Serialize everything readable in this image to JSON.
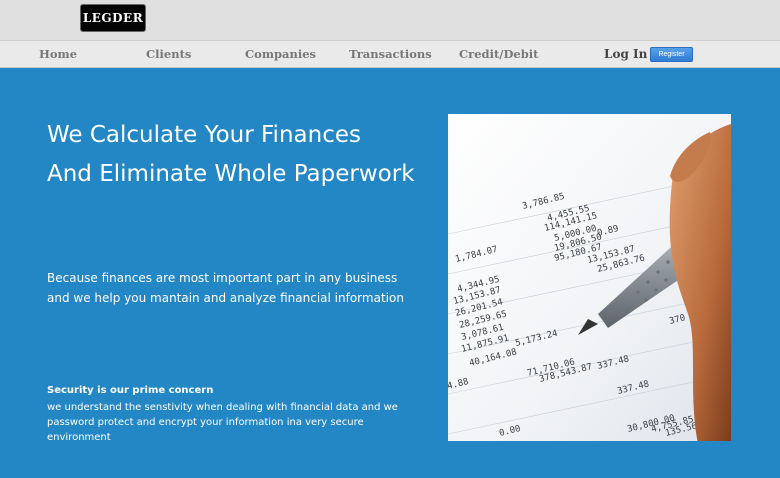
{
  "brand": {
    "logo_text": "LEGDER"
  },
  "nav": {
    "items": [
      "Home",
      "Clients",
      "Companies",
      "Transactions",
      "Credit/Debit"
    ],
    "login_label": "Log In",
    "register_label": "Register"
  },
  "hero": {
    "headline_line1": "We Calculate Your Finances",
    "headline_line2": "And Eliminate Whole Paperwork",
    "tagline_line1": "Because finances are most important part in any business",
    "tagline_line2": "and we help you mantain and analyze financial information",
    "security_title": "Security is our prime concern",
    "security_line1": "we understand the senstivity when dealing with financial data and we",
    "security_line2": "password protect and encrypt your information ina very secure",
    "security_line3": "environment"
  },
  "photo": {
    "figures": [
      "3,786.85",
      "4,455.55",
      "114,141.15",
      "5,000.00",
      "19,806.50",
      "95,180.67",
      "0.89",
      "13,153.87",
      "25,863.76",
      "1,784.07",
      "4,344.95",
      "13,153.87",
      "26,201.54",
      "28,259.65",
      "3,078.61",
      "11,875.91",
      "40,164.08",
      "5,173.24",
      "71,710.06",
      "378,543.87",
      "337.48",
      "337.48",
      "30,800.00",
      "4,755.85",
      "135.56",
      "370",
      "0.00",
      "4.88"
    ]
  },
  "colors": {
    "hero_bg": "#2487c5",
    "register_btn": "#3a8ae0",
    "logo_bg": "#050505"
  }
}
